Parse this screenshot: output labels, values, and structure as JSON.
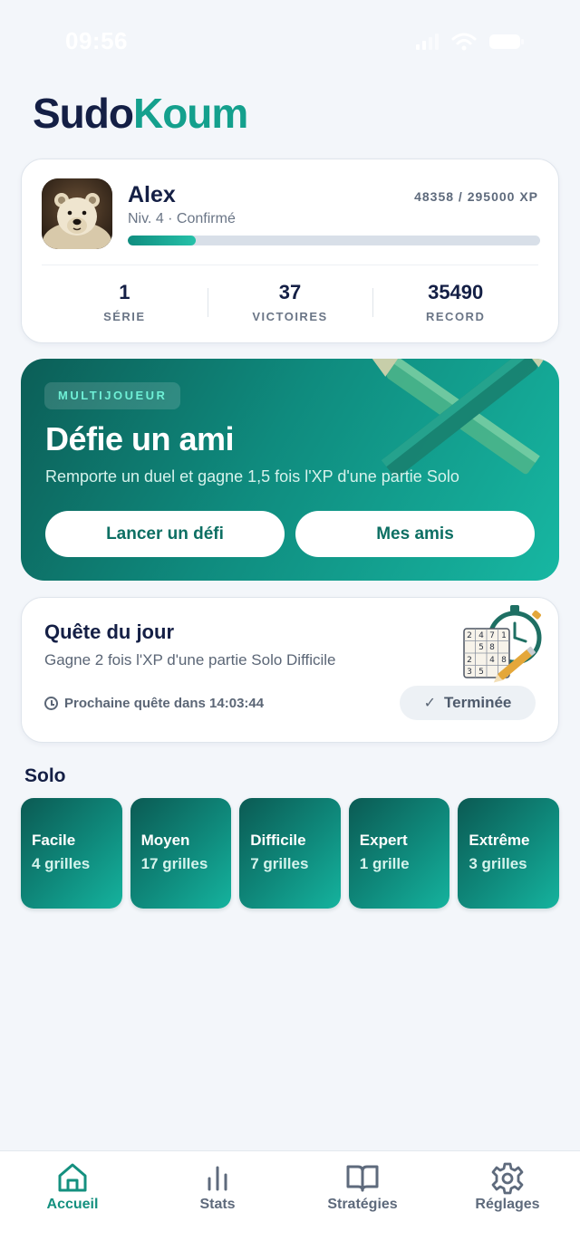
{
  "status_bar": {
    "time": "09:56"
  },
  "logo": {
    "part1": "Sudo",
    "part2": "Koum"
  },
  "profile": {
    "name": "Alex",
    "level": "Niv. 4 · Confirmé",
    "xp_text": "48358 / 295000 XP",
    "xp_progress": 0.164,
    "stats": [
      {
        "value": "1",
        "label": "SÉRIE"
      },
      {
        "value": "37",
        "label": "VICTOIRES"
      },
      {
        "value": "35490",
        "label": "RECORD"
      }
    ]
  },
  "multiplayer": {
    "badge": "MULTIJOUEUR",
    "title": "Défie un ami",
    "subtitle": "Remporte un duel et gagne 1,5 fois l'XP d'une partie Solo",
    "challenge_button": "Lancer un défi",
    "friends_button": "Mes amis"
  },
  "quest": {
    "title": "Quête du jour",
    "subtitle": "Gagne 2 fois l'XP d'une partie Solo Difficile",
    "next": "Prochaine quête dans 14:03:44",
    "status": "Terminée",
    "grid_digits": [
      "2",
      "4",
      "7",
      "1",
      "5",
      "8",
      "2",
      "4",
      "8",
      "3",
      "5"
    ]
  },
  "solo": {
    "title": "Solo",
    "levels": [
      {
        "name": "Facile",
        "count": "4 grilles"
      },
      {
        "name": "Moyen",
        "count": "17 grilles"
      },
      {
        "name": "Difficile",
        "count": "7 grilles"
      },
      {
        "name": "Expert",
        "count": "1 grille"
      },
      {
        "name": "Extrême",
        "count": "3 grilles"
      }
    ]
  },
  "nav": [
    {
      "label": "Accueil",
      "icon": "home-icon",
      "active": true
    },
    {
      "label": "Stats",
      "icon": "bar-chart-icon",
      "active": false
    },
    {
      "label": "Stratégies",
      "icon": "book-icon",
      "active": false
    },
    {
      "label": "Réglages",
      "icon": "gear-icon",
      "active": false
    }
  ],
  "colors": {
    "accent": "#14a08d",
    "brand_dark": "#141f45",
    "teal_dark": "#0c5e57"
  }
}
